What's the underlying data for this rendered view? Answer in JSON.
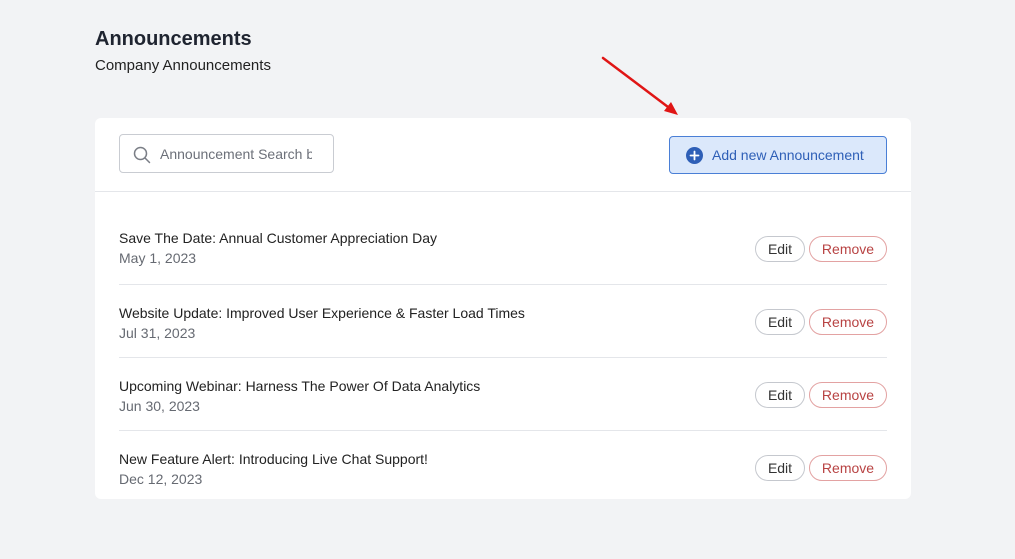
{
  "header": {
    "title": "Announcements",
    "subtitle": "Company Announcements"
  },
  "toolbar": {
    "search_placeholder": "Announcement Search by Title",
    "search_value": "",
    "add_label": "Add new Announcement"
  },
  "actions": {
    "edit_label": "Edit",
    "remove_label": "Remove"
  },
  "announcements": [
    {
      "title": "Save The Date: Annual Customer Appreciation Day",
      "date": "May 1, 2023"
    },
    {
      "title": "Website Update: Improved User Experience & Faster Load Times",
      "date": "Jul 31, 2023"
    },
    {
      "title": "Upcoming Webinar: Harness The Power Of Data Analytics",
      "date": "Jun 30, 2023"
    },
    {
      "title": "New Feature Alert: Introducing Live Chat Support!",
      "date": "Dec 12, 2023"
    }
  ],
  "colors": {
    "accent": "#2e5fb7",
    "accent_bg": "#dbe8fb",
    "danger": "#b84343",
    "annotation_arrow": "#e01515"
  },
  "icons": {
    "search": "search-icon",
    "add": "plus-circle-icon",
    "annotation": "arrow-icon"
  }
}
